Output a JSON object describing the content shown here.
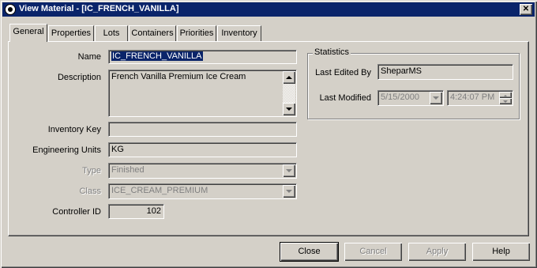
{
  "window": {
    "title": "View Material - [IC_FRENCH_VANILLA]"
  },
  "tabs": [
    {
      "label": "General"
    },
    {
      "label": "Properties"
    },
    {
      "label": "Lots"
    },
    {
      "label": "Containers"
    },
    {
      "label": "Priorities"
    },
    {
      "label": "Inventory"
    }
  ],
  "general": {
    "name_label": "Name",
    "name_value": "IC_FRENCH_VANILLA",
    "description_label": "Description",
    "description_value": "French Vanilla Premium Ice  Cream",
    "inventory_key_label": "Inventory Key",
    "inventory_key_value": "",
    "engineering_units_label": "Engineering Units",
    "engineering_units_value": "KG",
    "type_label": "Type",
    "type_value": "Finished",
    "class_label": "Class",
    "class_value": "ICE_CREAM_PREMIUM",
    "controller_id_label": "Controller ID",
    "controller_id_value": "102"
  },
  "statistics": {
    "title": "Statistics",
    "last_edited_by_label": "Last Edited By",
    "last_edited_by_value": "SheparMS",
    "last_modified_label": "Last Modified",
    "last_modified_date": "5/15/2000",
    "last_modified_time": "4:24:07 PM"
  },
  "buttons": {
    "close": "Close",
    "cancel": "Cancel",
    "apply": "Apply",
    "help": "Help"
  },
  "colors": {
    "titlebar": "#0a246a",
    "face": "#d4d0c8"
  }
}
